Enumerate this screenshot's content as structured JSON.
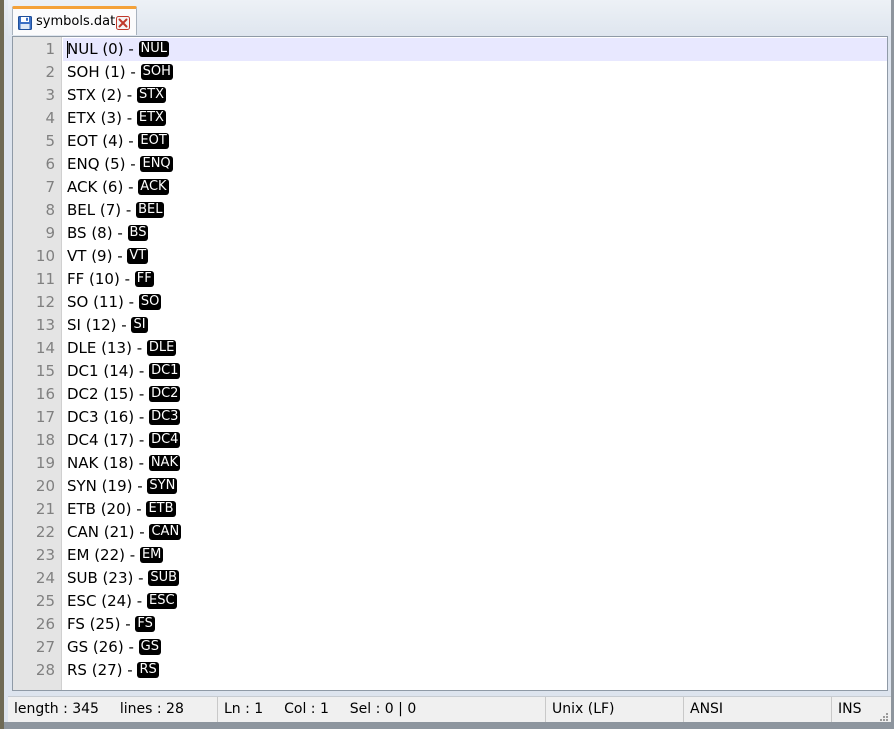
{
  "tab": {
    "filename": "symbols.dat",
    "icon": "save-disk-icon",
    "close_icon": "close-icon"
  },
  "editor": {
    "current_line": 1,
    "lines": [
      {
        "num": "1",
        "text": "NUL (0) - ",
        "symbol": "NUL"
      },
      {
        "num": "2",
        "text": "SOH (1) - ",
        "symbol": "SOH"
      },
      {
        "num": "3",
        "text": "STX (2) - ",
        "symbol": "STX"
      },
      {
        "num": "4",
        "text": "ETX (3) - ",
        "symbol": "ETX"
      },
      {
        "num": "5",
        "text": "EOT (4) - ",
        "symbol": "EOT"
      },
      {
        "num": "6",
        "text": "ENQ (5) - ",
        "symbol": "ENQ"
      },
      {
        "num": "7",
        "text": "ACK (6) - ",
        "symbol": "ACK"
      },
      {
        "num": "8",
        "text": "BEL (7) - ",
        "symbol": "BEL"
      },
      {
        "num": "9",
        "text": "BS (8) - ",
        "symbol": "BS"
      },
      {
        "num": "10",
        "text": "VT (9) - ",
        "symbol": "VT"
      },
      {
        "num": "11",
        "text": "FF (10) - ",
        "symbol": "FF"
      },
      {
        "num": "12",
        "text": "SO (11) - ",
        "symbol": "SO"
      },
      {
        "num": "13",
        "text": "SI (12) - ",
        "symbol": "SI"
      },
      {
        "num": "14",
        "text": "DLE (13) - ",
        "symbol": "DLE"
      },
      {
        "num": "15",
        "text": "DC1 (14) - ",
        "symbol": "DC1"
      },
      {
        "num": "16",
        "text": "DC2 (15) - ",
        "symbol": "DC2"
      },
      {
        "num": "17",
        "text": "DC3 (16) - ",
        "symbol": "DC3"
      },
      {
        "num": "18",
        "text": "DC4 (17) - ",
        "symbol": "DC4"
      },
      {
        "num": "19",
        "text": "NAK (18) - ",
        "symbol": "NAK"
      },
      {
        "num": "20",
        "text": "SYN (19) - ",
        "symbol": "SYN"
      },
      {
        "num": "21",
        "text": "ETB (20) - ",
        "symbol": "ETB"
      },
      {
        "num": "22",
        "text": "CAN (21) - ",
        "symbol": "CAN"
      },
      {
        "num": "23",
        "text": "EM (22) - ",
        "symbol": "EM"
      },
      {
        "num": "24",
        "text": "SUB (23) - ",
        "symbol": "SUB"
      },
      {
        "num": "25",
        "text": "ESC (24) - ",
        "symbol": "ESC"
      },
      {
        "num": "26",
        "text": "FS (25) - ",
        "symbol": "FS"
      },
      {
        "num": "27",
        "text": "GS (26) - ",
        "symbol": "GS"
      },
      {
        "num": "28",
        "text": "RS (27) - ",
        "symbol": "RS"
      }
    ]
  },
  "statusbar": {
    "length": "length : 345",
    "lines": "lines : 28",
    "ln": "Ln : 1",
    "col": "Col : 1",
    "sel": "Sel : 0 | 0",
    "eol": "Unix (LF)",
    "encoding": "ANSI",
    "mode": "INS"
  },
  "colors": {
    "tab_accent": "#f4a23a",
    "current_line_bg": "#e8e8ff",
    "gutter_bg": "#e4e4e4",
    "gutter_text": "#808080",
    "ctrl_symbol_bg": "#000000",
    "ctrl_symbol_fg": "#ffffff"
  }
}
